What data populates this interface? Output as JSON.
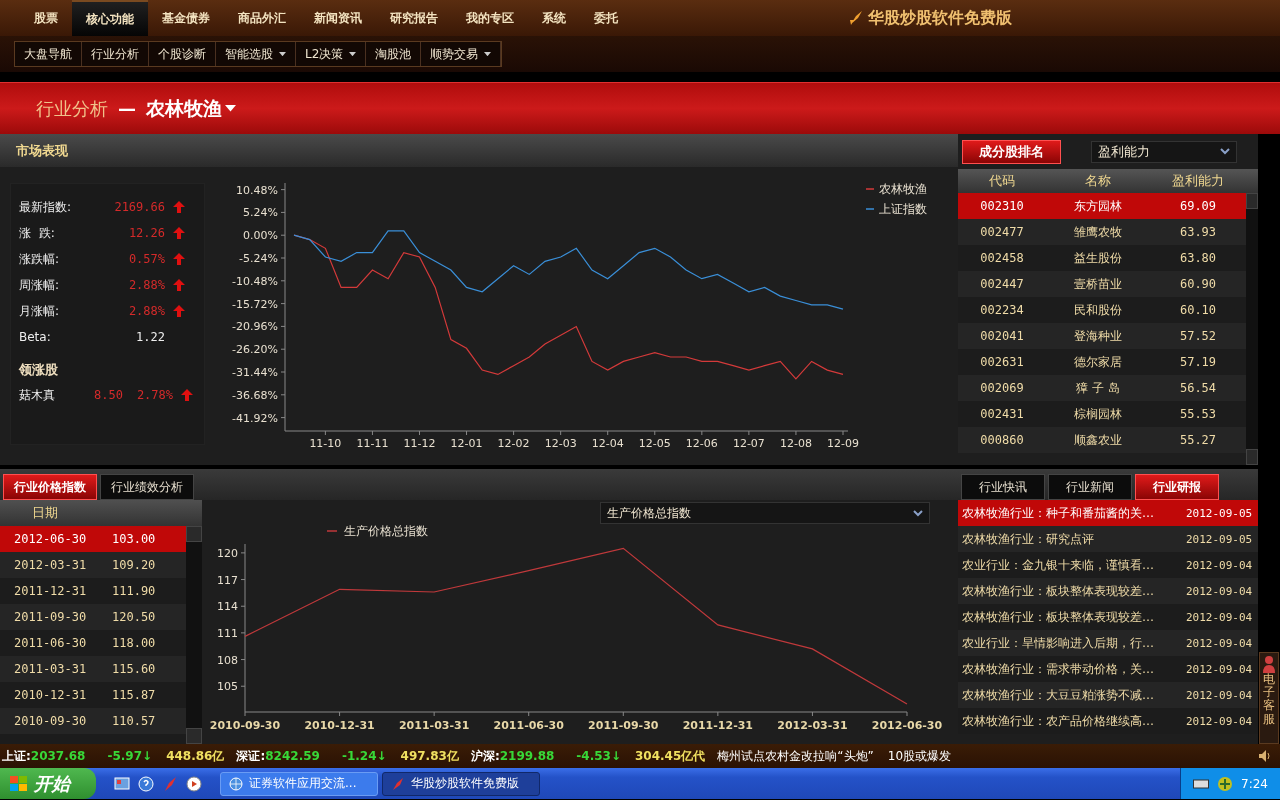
{
  "nav": {
    "tabs": [
      {
        "label": "股票",
        "selected": false
      },
      {
        "label": "核心功能",
        "selected": true
      },
      {
        "label": "基金债券",
        "selected": false
      },
      {
        "label": "商品外汇",
        "selected": false
      },
      {
        "label": "新闻资讯",
        "selected": false
      },
      {
        "label": "研究报告",
        "selected": false
      },
      {
        "label": "我的专区",
        "selected": false
      },
      {
        "label": "系统",
        "selected": false
      },
      {
        "label": "委托",
        "selected": false
      }
    ],
    "brand": "华股炒股软件免费版"
  },
  "subnav": [
    {
      "label": "大盘导航",
      "dropdown": false
    },
    {
      "label": "行业分析",
      "dropdown": false
    },
    {
      "label": "个股诊断",
      "dropdown": false
    },
    {
      "label": "智能选股",
      "dropdown": true
    },
    {
      "label": "L2决策",
      "dropdown": true
    },
    {
      "label": "淘股池",
      "dropdown": false
    },
    {
      "label": "顺势交易",
      "dropdown": true
    }
  ],
  "banner": {
    "section": "行业分析",
    "separator": "—",
    "industry": "农林牧渔"
  },
  "market": {
    "title": "市场表现",
    "stats": [
      {
        "label": "最新指数:",
        "value": "2169.66",
        "rising": true
      },
      {
        "label": "涨  跌:",
        "value": "12.26",
        "rising": true
      },
      {
        "label": "涨跌幅:",
        "value": "0.57%",
        "rising": true
      },
      {
        "label": "周涨幅:",
        "value": "2.88%",
        "rising": true
      },
      {
        "label": "月涨幅:",
        "value": "2.88%",
        "rising": true
      },
      {
        "label": "Beta:",
        "value": "1.22",
        "rising": false
      }
    ],
    "leaders_title": "领涨股",
    "leaders": [
      {
        "name": "菇木真",
        "price": "8.50",
        "change": "2.78%",
        "rising": true
      }
    ],
    "chart_data": {
      "type": "line",
      "categories": [
        null,
        null,
        "11-10",
        null,
        null,
        "11-11",
        null,
        null,
        "11-12",
        null,
        null,
        "12-01",
        null,
        null,
        "12-02",
        null,
        null,
        "12-03",
        null,
        null,
        "12-04",
        null,
        null,
        "12-05",
        null,
        null,
        "12-06",
        null,
        null,
        "12-07",
        null,
        null,
        "12-08",
        null,
        null,
        "12-09"
      ],
      "series": [
        {
          "name": "农林牧渔",
          "color": "#d43a3a",
          "values": [
            0,
            -1,
            -3,
            -12,
            -12,
            -8,
            -10,
            -4,
            -5,
            -12,
            -24,
            -26,
            -31,
            -32,
            -30,
            -28,
            -25,
            -23,
            -21,
            -29,
            -31,
            -29,
            -28,
            -27,
            -28,
            -28,
            -29,
            -29,
            -30,
            -31,
            -30,
            -29,
            -33,
            -29,
            -31,
            -32
          ]
        },
        {
          "name": "上证指数",
          "color": "#3a8fd8",
          "values": [
            0,
            -1,
            -5,
            -6,
            -4,
            -4,
            1,
            1,
            -4,
            -6,
            -8,
            -12,
            -13,
            -10,
            -7,
            -9,
            -6,
            -5,
            -3,
            -8,
            -10,
            -7,
            -4,
            -3,
            -5,
            -8,
            -10,
            -9,
            -11,
            -13,
            -12,
            -14,
            -15,
            -16,
            -16,
            -17
          ]
        }
      ],
      "ylim": [
        -45,
        12
      ],
      "legend": "top-right",
      "yticks": [
        {
          "value": 10.48,
          "label": "10.48%"
        },
        {
          "value": 5.24,
          "label": "5.24%"
        },
        {
          "value": 0,
          "label": "0.00%"
        },
        {
          "value": -5.24,
          "label": "-5.24%"
        },
        {
          "value": -10.48,
          "label": "-10.48%"
        },
        {
          "value": -15.72,
          "label": "-15.72%"
        },
        {
          "value": -20.96,
          "label": "-20.96%"
        },
        {
          "value": -26.2,
          "label": "-26.20%"
        },
        {
          "value": -31.44,
          "label": "-31.44%"
        },
        {
          "value": -36.68,
          "label": "-36.68%"
        },
        {
          "value": -41.92,
          "label": "-41.92%"
        }
      ]
    }
  },
  "ranking": {
    "button": "成分股排名",
    "select": "盈利能力",
    "columns": [
      "代码",
      "名称",
      "盈利能力"
    ],
    "rows": [
      {
        "code": "002310",
        "name": "东方园林",
        "value": "69.09",
        "selected": true
      },
      {
        "code": "002477",
        "name": "雏鹰农牧",
        "value": "63.93",
        "selected": false
      },
      {
        "code": "002458",
        "name": "益生股份",
        "value": "63.80",
        "selected": false
      },
      {
        "code": "002447",
        "name": "壹桥苗业",
        "value": "60.90",
        "selected": false
      },
      {
        "code": "002234",
        "name": "民和股份",
        "value": "60.10",
        "selected": false
      },
      {
        "code": "002041",
        "name": "登海种业",
        "value": "57.52",
        "selected": false
      },
      {
        "code": "002631",
        "name": "德尔家居",
        "value": "57.19",
        "selected": false
      },
      {
        "code": "002069",
        "name": "獐 子 岛",
        "value": "56.54",
        "selected": false
      },
      {
        "code": "002431",
        "name": "棕榈园林",
        "value": "55.53",
        "selected": false
      },
      {
        "code": "000860",
        "name": "顺鑫农业",
        "value": "55.27",
        "selected": false
      }
    ]
  },
  "price_index": {
    "tabs": [
      {
        "label": "行业价格指数",
        "selected": true
      },
      {
        "label": "行业绩效分析",
        "selected": false
      }
    ],
    "column": "日期",
    "rows": [
      {
        "date": "2012-06-30",
        "value": "103.00",
        "selected": true
      },
      {
        "date": "2012-03-31",
        "value": "109.20",
        "selected": false
      },
      {
        "date": "2011-12-31",
        "value": "111.90",
        "selected": false
      },
      {
        "date": "2011-09-30",
        "value": "120.50",
        "selected": false
      },
      {
        "date": "2011-06-30",
        "value": "118.00",
        "selected": false
      },
      {
        "date": "2011-03-31",
        "value": "115.60",
        "selected": false
      },
      {
        "date": "2010-12-31",
        "value": "115.87",
        "selected": false
      },
      {
        "date": "2010-09-30",
        "value": "110.57",
        "selected": false
      }
    ],
    "select": "生产价格总指数",
    "chart_data": {
      "type": "line",
      "categories": [
        "2010-09-30",
        "2010-12-31",
        "2011-03-31",
        "2011-06-30",
        "2011-09-30",
        "2011-12-31",
        "2012-03-31",
        "2012-06-30"
      ],
      "series": [
        {
          "name": "生产价格总指数",
          "color": "#c0393b",
          "values": [
            110.6,
            115.9,
            115.6,
            118,
            120.5,
            111.9,
            109.2,
            103
          ]
        }
      ],
      "ylim": [
        102.1,
        121
      ],
      "legend": "top-left",
      "yticks": [
        105,
        108,
        111,
        114,
        117,
        120
      ]
    }
  },
  "news": {
    "tabs": [
      {
        "label": "行业快讯",
        "selected": false
      },
      {
        "label": "行业新闻",
        "selected": false
      },
      {
        "label": "行业研报",
        "selected": true
      }
    ],
    "rows": [
      {
        "title": "农林牧渔行业：种子和番茄酱的关…",
        "date": "2012-09-05",
        "selected": true
      },
      {
        "title": "农林牧渔行业：研究点评",
        "date": "2012-09-05",
        "selected": false
      },
      {
        "title": "农业行业：金九银十来临，谨慎看…",
        "date": "2012-09-04",
        "selected": false
      },
      {
        "title": "农林牧渔行业：板块整体表现较差…",
        "date": "2012-09-04",
        "selected": false
      },
      {
        "title": "农林牧渔行业：板块整体表现较差…",
        "date": "2012-09-04",
        "selected": false
      },
      {
        "title": "农业行业：旱情影响进入后期，行…",
        "date": "2012-09-04",
        "selected": false
      },
      {
        "title": "农林牧渔行业：需求带动价格，关…",
        "date": "2012-09-04",
        "selected": false
      },
      {
        "title": "农林牧渔行业：大豆豆粕涨势不减…",
        "date": "2012-09-04",
        "selected": false
      },
      {
        "title": "农林牧渔行业：农产品价格继续高…",
        "date": "2012-09-04",
        "selected": false
      }
    ]
  },
  "service_tab": "电子客服",
  "ticker": [
    {
      "kind": "index",
      "label": "上证:",
      "value": "2037.68"
    },
    {
      "kind": "change",
      "text": "-5.97↓"
    },
    {
      "kind": "amount",
      "text": "448.86亿"
    },
    {
      "kind": "index",
      "label": "深证:",
      "value": "8242.59"
    },
    {
      "kind": "change",
      "text": "-1.24↓"
    },
    {
      "kind": "amount",
      "text": "497.83亿"
    },
    {
      "kind": "index",
      "label": "沪深:",
      "value": "2199.88"
    },
    {
      "kind": "change",
      "text": "-4.53↓"
    },
    {
      "kind": "amount",
      "text": "304.45亿代"
    },
    {
      "kind": "news",
      "text": "梅州试点农村金改拉响“头炮”"
    },
    {
      "kind": "news",
      "text": "10股或爆发"
    }
  ],
  "taskbar": {
    "start": "开始",
    "tasks": [
      {
        "label": "证券软件应用交流...",
        "selected": false
      },
      {
        "label": "华股炒股软件免费版",
        "selected": true
      }
    ],
    "clock": "7:24"
  }
}
